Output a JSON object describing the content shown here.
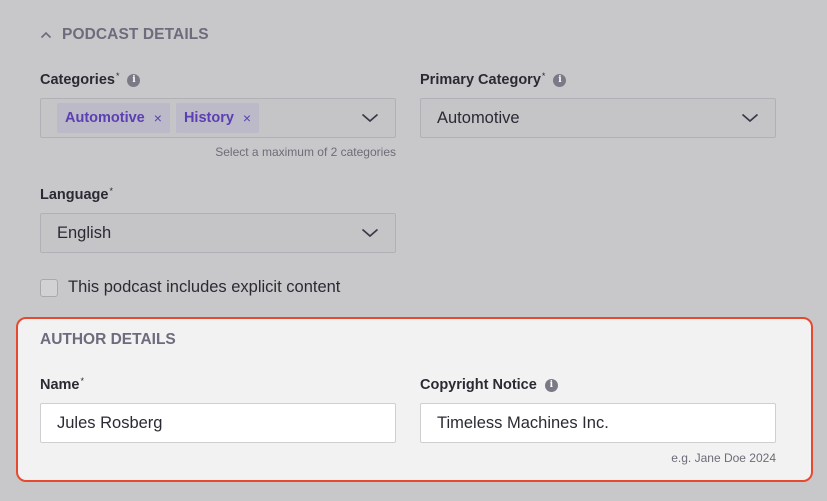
{
  "podcast_details": {
    "title": "PODCAST DETAILS",
    "categories": {
      "label": "Categories",
      "required_mark": "*",
      "chips": [
        {
          "label": "Automotive",
          "remove": "×"
        },
        {
          "label": "History",
          "remove": "×"
        }
      ],
      "help": "Select a maximum of 2 categories"
    },
    "primary_category": {
      "label": "Primary Category",
      "required_mark": "*",
      "value": "Automotive"
    },
    "language": {
      "label": "Language",
      "required_mark": "*",
      "value": "English"
    },
    "explicit": {
      "label": "This podcast includes explicit content",
      "checked": false
    }
  },
  "author_details": {
    "title": "AUTHOR DETAILS",
    "name": {
      "label": "Name",
      "required_mark": "*",
      "value": "Jules Rosberg"
    },
    "copyright": {
      "label": "Copyright Notice",
      "value": "Timeless Machines Inc.",
      "help": "e.g. Jane Doe 2024"
    }
  },
  "colors": {
    "highlight_border": "#e8492e",
    "chip_text": "#5b3fb3"
  },
  "icons": {
    "info": "info-icon",
    "dropdown": "chevron-down-icon",
    "collapse": "chevron-up-icon",
    "remove": "close-icon"
  }
}
